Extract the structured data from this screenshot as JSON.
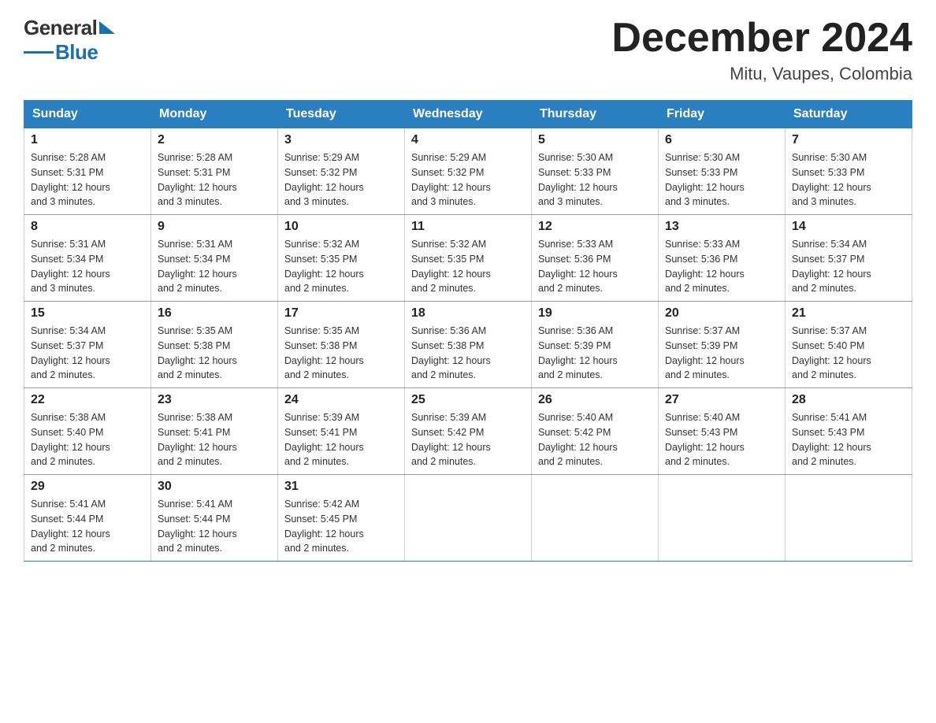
{
  "header": {
    "logo": {
      "general": "General",
      "blue": "Blue"
    },
    "title": "December 2024",
    "location": "Mitu, Vaupes, Colombia"
  },
  "calendar": {
    "days_of_week": [
      "Sunday",
      "Monday",
      "Tuesday",
      "Wednesday",
      "Thursday",
      "Friday",
      "Saturday"
    ],
    "weeks": [
      [
        {
          "day": "1",
          "sunrise": "5:28 AM",
          "sunset": "5:31 PM",
          "daylight": "12 hours and 3 minutes."
        },
        {
          "day": "2",
          "sunrise": "5:28 AM",
          "sunset": "5:31 PM",
          "daylight": "12 hours and 3 minutes."
        },
        {
          "day": "3",
          "sunrise": "5:29 AM",
          "sunset": "5:32 PM",
          "daylight": "12 hours and 3 minutes."
        },
        {
          "day": "4",
          "sunrise": "5:29 AM",
          "sunset": "5:32 PM",
          "daylight": "12 hours and 3 minutes."
        },
        {
          "day": "5",
          "sunrise": "5:30 AM",
          "sunset": "5:33 PM",
          "daylight": "12 hours and 3 minutes."
        },
        {
          "day": "6",
          "sunrise": "5:30 AM",
          "sunset": "5:33 PM",
          "daylight": "12 hours and 3 minutes."
        },
        {
          "day": "7",
          "sunrise": "5:30 AM",
          "sunset": "5:33 PM",
          "daylight": "12 hours and 3 minutes."
        }
      ],
      [
        {
          "day": "8",
          "sunrise": "5:31 AM",
          "sunset": "5:34 PM",
          "daylight": "12 hours and 3 minutes."
        },
        {
          "day": "9",
          "sunrise": "5:31 AM",
          "sunset": "5:34 PM",
          "daylight": "12 hours and 2 minutes."
        },
        {
          "day": "10",
          "sunrise": "5:32 AM",
          "sunset": "5:35 PM",
          "daylight": "12 hours and 2 minutes."
        },
        {
          "day": "11",
          "sunrise": "5:32 AM",
          "sunset": "5:35 PM",
          "daylight": "12 hours and 2 minutes."
        },
        {
          "day": "12",
          "sunrise": "5:33 AM",
          "sunset": "5:36 PM",
          "daylight": "12 hours and 2 minutes."
        },
        {
          "day": "13",
          "sunrise": "5:33 AM",
          "sunset": "5:36 PM",
          "daylight": "12 hours and 2 minutes."
        },
        {
          "day": "14",
          "sunrise": "5:34 AM",
          "sunset": "5:37 PM",
          "daylight": "12 hours and 2 minutes."
        }
      ],
      [
        {
          "day": "15",
          "sunrise": "5:34 AM",
          "sunset": "5:37 PM",
          "daylight": "12 hours and 2 minutes."
        },
        {
          "day": "16",
          "sunrise": "5:35 AM",
          "sunset": "5:38 PM",
          "daylight": "12 hours and 2 minutes."
        },
        {
          "day": "17",
          "sunrise": "5:35 AM",
          "sunset": "5:38 PM",
          "daylight": "12 hours and 2 minutes."
        },
        {
          "day": "18",
          "sunrise": "5:36 AM",
          "sunset": "5:38 PM",
          "daylight": "12 hours and 2 minutes."
        },
        {
          "day": "19",
          "sunrise": "5:36 AM",
          "sunset": "5:39 PM",
          "daylight": "12 hours and 2 minutes."
        },
        {
          "day": "20",
          "sunrise": "5:37 AM",
          "sunset": "5:39 PM",
          "daylight": "12 hours and 2 minutes."
        },
        {
          "day": "21",
          "sunrise": "5:37 AM",
          "sunset": "5:40 PM",
          "daylight": "12 hours and 2 minutes."
        }
      ],
      [
        {
          "day": "22",
          "sunrise": "5:38 AM",
          "sunset": "5:40 PM",
          "daylight": "12 hours and 2 minutes."
        },
        {
          "day": "23",
          "sunrise": "5:38 AM",
          "sunset": "5:41 PM",
          "daylight": "12 hours and 2 minutes."
        },
        {
          "day": "24",
          "sunrise": "5:39 AM",
          "sunset": "5:41 PM",
          "daylight": "12 hours and 2 minutes."
        },
        {
          "day": "25",
          "sunrise": "5:39 AM",
          "sunset": "5:42 PM",
          "daylight": "12 hours and 2 minutes."
        },
        {
          "day": "26",
          "sunrise": "5:40 AM",
          "sunset": "5:42 PM",
          "daylight": "12 hours and 2 minutes."
        },
        {
          "day": "27",
          "sunrise": "5:40 AM",
          "sunset": "5:43 PM",
          "daylight": "12 hours and 2 minutes."
        },
        {
          "day": "28",
          "sunrise": "5:41 AM",
          "sunset": "5:43 PM",
          "daylight": "12 hours and 2 minutes."
        }
      ],
      [
        {
          "day": "29",
          "sunrise": "5:41 AM",
          "sunset": "5:44 PM",
          "daylight": "12 hours and 2 minutes."
        },
        {
          "day": "30",
          "sunrise": "5:41 AM",
          "sunset": "5:44 PM",
          "daylight": "12 hours and 2 minutes."
        },
        {
          "day": "31",
          "sunrise": "5:42 AM",
          "sunset": "5:45 PM",
          "daylight": "12 hours and 2 minutes."
        },
        null,
        null,
        null,
        null
      ]
    ],
    "labels": {
      "sunrise": "Sunrise:",
      "sunset": "Sunset:",
      "daylight": "Daylight:"
    }
  }
}
